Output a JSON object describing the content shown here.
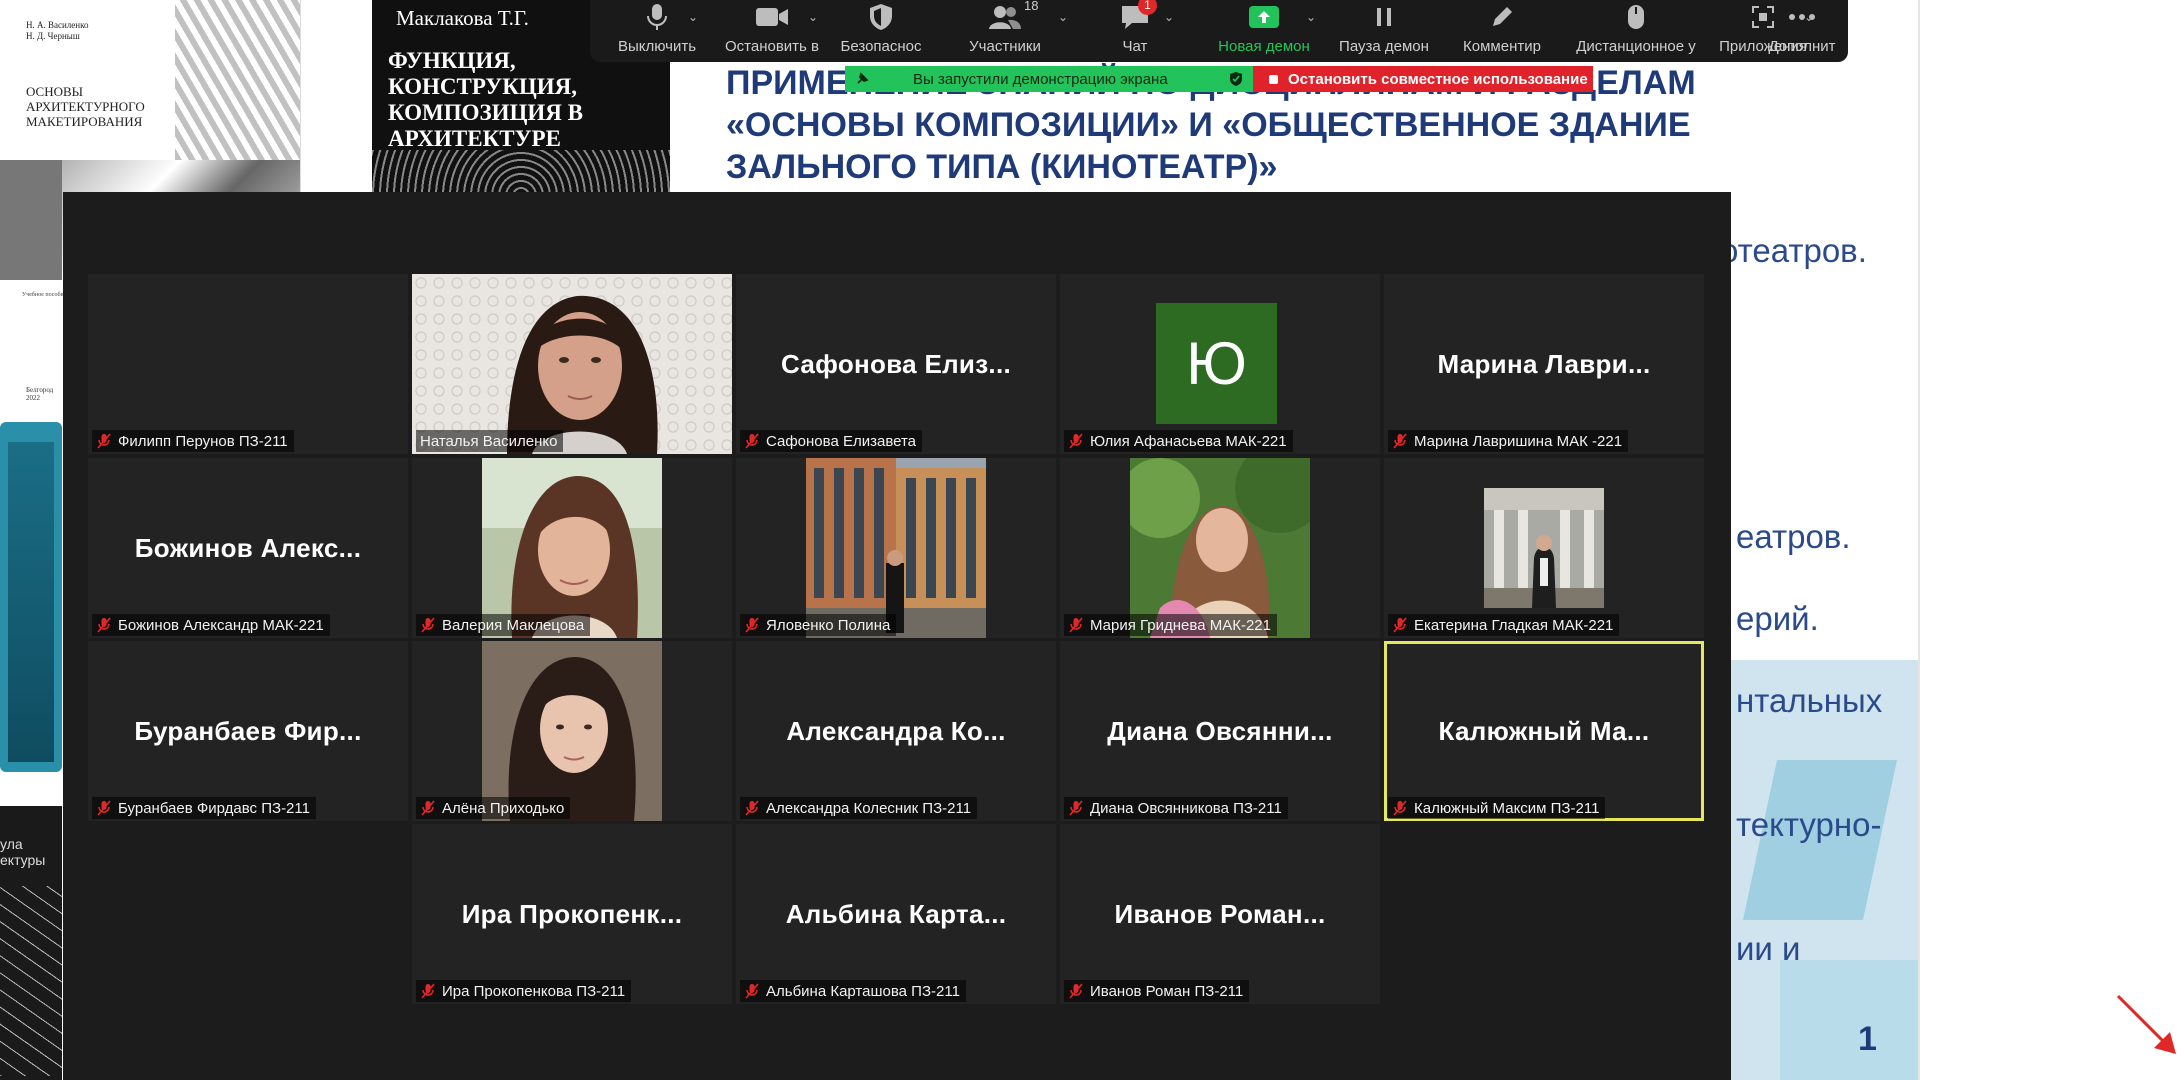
{
  "slide": {
    "title": "ПРИМЕНЕНИЕ ЗНАНИЙ ПО ДИСЦИПЛИНАМ И РАЗДЕЛАМ «ОСНОВЫ КОМПОЗИЦИИ» И «ОБЩЕСТВЕННОЕ ЗДАНИЕ ЗАЛЬНОГО ТИПА (КИНОТЕАТР)»",
    "fragments": [
      "отеатров.",
      "еатров.",
      "ерий.",
      "нтальных",
      "тектурно-",
      "ии и"
    ],
    "page_number": "1",
    "books": {
      "book1_authors": "Н. А. Василенко\nН. Д. Черныш",
      "book1_title": "ОСНОВЫ АРХИТЕКТУРНОГО МАКЕТИРОВАНИЯ",
      "book1_sub": "Учебное пособие",
      "book1_place": "Белгород\n2022",
      "book2_author": "Маклакова Т.Г.",
      "book2_title": "ФУНКЦИЯ, КОНСТРУКЦИЯ, КОМПОЗИЦИЯ В АРХИТЕКТУРЕ",
      "book4_text": "ула\nектуры"
    }
  },
  "toolbar": {
    "mute_label": "Выключить",
    "video_label": "Остановить в",
    "security_label": "Безопаснос",
    "participants_label": "Участники",
    "participants_count": "18",
    "chat_label": "Чат",
    "chat_badge": "1",
    "new_share_label": "Новая демон",
    "pause_label": "Пауза демон",
    "annotate_label": "Комментир",
    "remote_label": "Дистанционное у",
    "apps_label": "Приложения",
    "more_label": "Дополнит"
  },
  "sharing": {
    "banner_text": "Вы запустили демонстрацию экрана",
    "stop_text": "Остановить совместное использование"
  },
  "participants": [
    {
      "label": "Филипп Перунов ПЗ-211",
      "display": "",
      "kind": "blank"
    },
    {
      "label": "Наталья Василенко",
      "display": "",
      "kind": "video"
    },
    {
      "label": "Сафонова Елизавета",
      "display": "Сафонова  Елиз...",
      "kind": "name"
    },
    {
      "label": "Юлия Афанасьева МАК-221",
      "display": "Ю",
      "kind": "avatar"
    },
    {
      "label": "Марина Лавришина МАК -221",
      "display": "Марина  Лаври...",
      "kind": "name"
    },
    {
      "label": "Божинов Александр МАК-221",
      "display": "Божинов  Алекс...",
      "kind": "name"
    },
    {
      "label": "Валерия Маклецова",
      "display": "",
      "kind": "video"
    },
    {
      "label": "Яловенко Полина",
      "display": "",
      "kind": "video"
    },
    {
      "label": "Мария Гриднева МАК-221",
      "display": "",
      "kind": "video"
    },
    {
      "label": "Екатерина Гладкая МАК-221",
      "display": "",
      "kind": "video"
    },
    {
      "label": "Буранбаев Фирдавс ПЗ-211",
      "display": "Буранбаев  Фир...",
      "kind": "name"
    },
    {
      "label": "Алёна Приходько",
      "display": "",
      "kind": "video"
    },
    {
      "label": "Александра Колесник ПЗ-211",
      "display": "Александра  Ко...",
      "kind": "name"
    },
    {
      "label": "Диана Овсянникова ПЗ-211",
      "display": "Диана  Овсянни...",
      "kind": "name"
    },
    {
      "label": "Калюжный Максим ПЗ-211",
      "display": "Калюжный  Ма...",
      "kind": "name",
      "active": true
    },
    {
      "label": "Ира Прокопенкова ПЗ-211",
      "display": "Ира  Прокопенк...",
      "kind": "name"
    },
    {
      "label": "Альбина Карташова ПЗ-211",
      "display": "Альбина  Карта...",
      "kind": "name"
    },
    {
      "label": "Иванов Роман ПЗ-211",
      "display": "Иванов  Роман...",
      "kind": "name"
    }
  ],
  "colors": {
    "toolbar_bg": "#1a1a1a",
    "share_green": "#23c35b",
    "stop_red": "#e0232b",
    "active_speaker": "#e6e661",
    "slide_title": "#1f3a78",
    "muted_icon": "#e02828"
  }
}
